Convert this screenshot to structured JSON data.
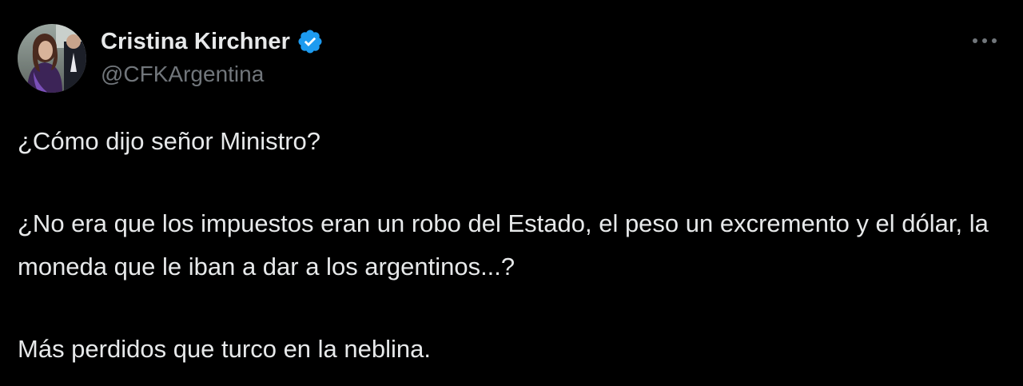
{
  "tweet": {
    "author": {
      "display_name": "Cristina Kirchner",
      "handle": "@CFKArgentina",
      "verified": true,
      "verified_icon": "verified-badge-icon"
    },
    "more_icon": "more-options-icon",
    "paragraphs": [
      "¿Cómo dijo señor Ministro?",
      "¿No era que los impuestos eran un robo del Estado, el peso un excremento y el dólar, la moneda que le iban a dar a los argentinos...?",
      "Más perdidos que turco en la neblina."
    ]
  },
  "colors": {
    "background": "#000000",
    "text_primary": "#e7e9ea",
    "text_secondary": "#71767b",
    "verified_blue": "#1d9bf0"
  }
}
